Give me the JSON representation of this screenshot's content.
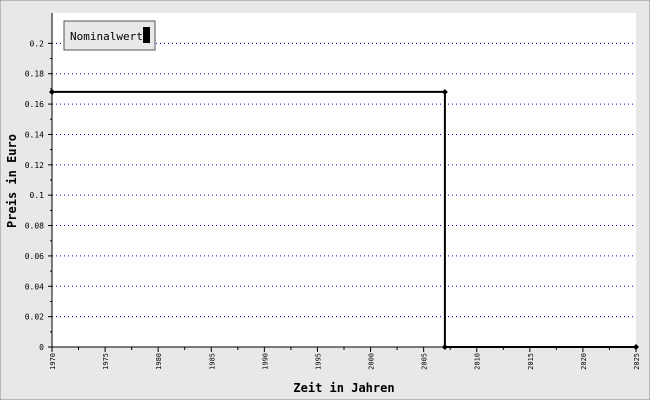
{
  "chart_data": {
    "type": "line",
    "step": true,
    "xlabel": "Zeit in Jahren",
    "ylabel": "Preis in Euro",
    "xlim": [
      1970,
      2025
    ],
    "ylim": [
      0,
      0.22
    ],
    "x_ticks": [
      1970,
      1975,
      1980,
      1985,
      1990,
      1995,
      2000,
      2005,
      2010,
      2015,
      2020,
      2025
    ],
    "y_ticks": [
      0,
      0.02,
      0.04,
      0.06,
      0.08,
      0.1,
      0.12,
      0.14,
      0.16,
      0.18,
      0.2
    ],
    "y_tick_labels": [
      "0",
      "0.02",
      "0.04",
      "0.06",
      "0.08",
      "0.1",
      "0.12",
      "0.14",
      "0.16",
      "0.18",
      "0.2"
    ],
    "grid": "horizontal dotted",
    "legend_position": "top-left",
    "series": [
      {
        "name": "Nominalwert",
        "color": "#000000",
        "points": [
          {
            "x": 1970,
            "y": 0.168
          },
          {
            "x": 2007,
            "y": 0.168
          },
          {
            "x": 2007,
            "y": 0
          },
          {
            "x": 2025,
            "y": 0
          }
        ]
      }
    ]
  },
  "colors": {
    "frame_background": "#e8e8e8",
    "plot_background": "#ffffff",
    "grid": "#0000cc",
    "line": "#000000"
  }
}
